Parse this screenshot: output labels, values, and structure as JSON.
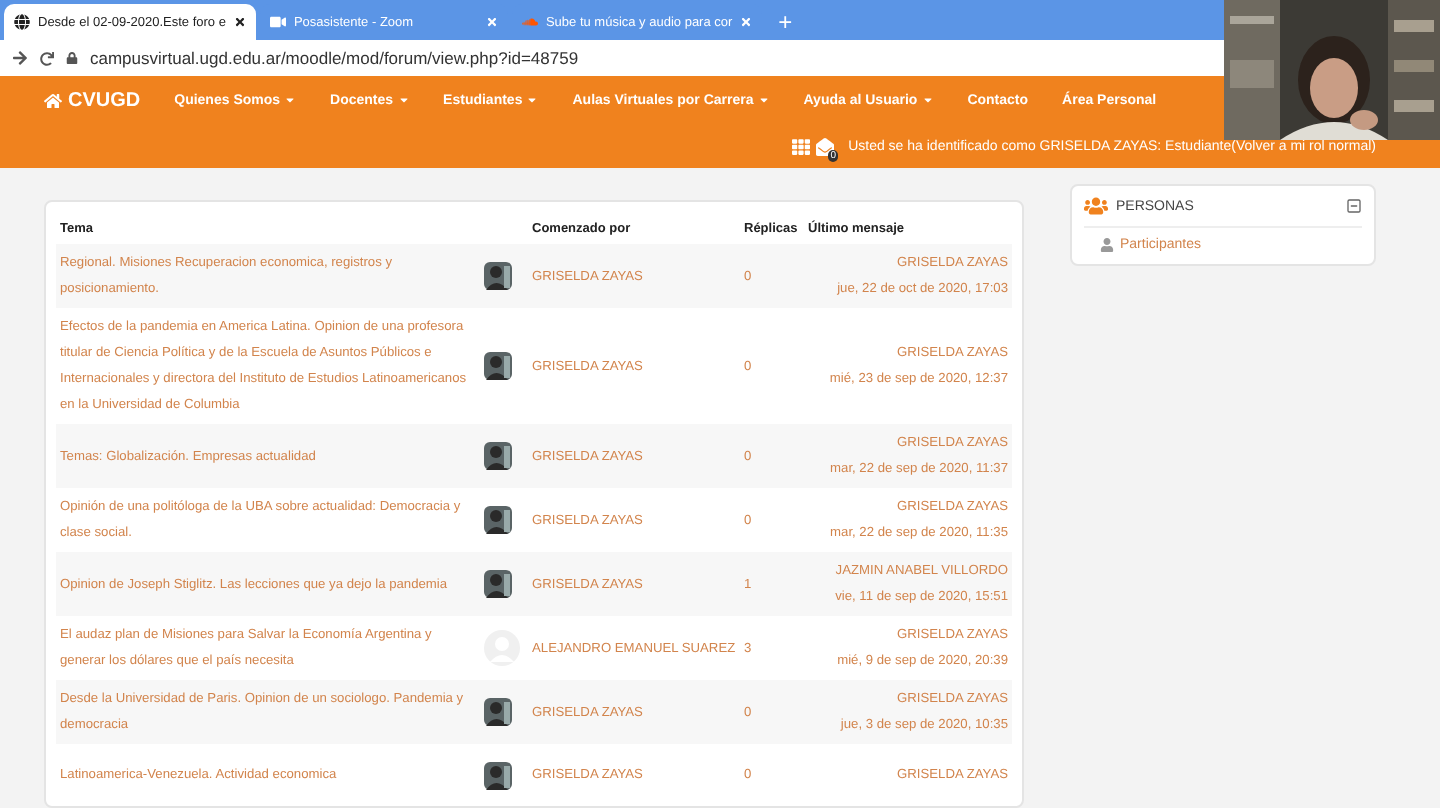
{
  "browser": {
    "tabs": [
      {
        "label": "Desde el 02-09-2020.Este foro e",
        "selected": true
      },
      {
        "label": "Posasistente - Zoom",
        "selected": false
      },
      {
        "label": "Sube tu música y audio para cor",
        "selected": false
      }
    ],
    "new_tab": "+",
    "url": "campusvirtual.ugd.edu.ar/moodle/mod/forum/view.php?id=48759"
  },
  "navbar": {
    "brand": "CVUGD",
    "items": [
      {
        "label": "Quienes Somos",
        "dropdown": true
      },
      {
        "label": "Docentes",
        "dropdown": true
      },
      {
        "label": "Estudiantes",
        "dropdown": true
      },
      {
        "label": "Aulas Virtuales por Carrera",
        "dropdown": true
      },
      {
        "label": "Ayuda al Usuario",
        "dropdown": true
      },
      {
        "label": "Contacto",
        "dropdown": false
      },
      {
        "label": "Área Personal",
        "dropdown": false
      }
    ],
    "notification_count": "0",
    "login_text": "Usted se ha identificado como GRISELDA ZAYAS: Estudiante",
    "login_link": "(Volver a mi rol normal)"
  },
  "table": {
    "columns": [
      "Tema",
      "Comenzado por",
      "Réplicas",
      "Último mensaje"
    ],
    "rows": [
      {
        "topic": "Regional. Misiones Recuperacion economica, registros y posicionamiento.",
        "author": "GRISELDA ZAYAS",
        "replies": "0",
        "last_author": "GRISELDA ZAYAS",
        "last_date": "jue, 22 de oct de 2020, 17:03"
      },
      {
        "topic": "Efectos de la pandemia en America Latina. Opinion de una profesora titular de Ciencia Política y de la Escuela de Asuntos Públicos e Internacionales y directora del Instituto de Estudios Latinoamericanos en la Universidad de Columbia",
        "author": "GRISELDA ZAYAS",
        "replies": "0",
        "last_author": "GRISELDA ZAYAS",
        "last_date": "mié, 23 de sep de 2020, 12:37"
      },
      {
        "topic": "Temas: Globalización. Empresas actualidad",
        "author": "GRISELDA ZAYAS",
        "replies": "0",
        "last_author": "GRISELDA ZAYAS",
        "last_date": "mar, 22 de sep de 2020, 11:37"
      },
      {
        "topic": "Opinión de una politóloga de la UBA sobre actualidad: Democracia y clase social.",
        "author": "GRISELDA ZAYAS",
        "replies": "0",
        "last_author": "GRISELDA ZAYAS",
        "last_date": "mar, 22 de sep de 2020, 11:35"
      },
      {
        "topic": "Opinion de Joseph Stiglitz. Las lecciones que ya dejo la pandemia",
        "author": "GRISELDA ZAYAS",
        "replies": "1",
        "last_author": "JAZMIN ANABEL VILLORDO",
        "last_date": "vie, 11 de sep de 2020, 15:51"
      },
      {
        "topic": "El audaz plan de Misiones para Salvar la Economía Argentina y generar los dólares que el país necesita",
        "kind": "blank",
        "author": "ALEJANDRO EMANUEL SUAREZ",
        "replies": "3",
        "last_author": "GRISELDA ZAYAS",
        "last_date": "mié, 9 de sep de 2020, 20:39"
      },
      {
        "topic": "Desde la Universidad de Paris. Opinion de un sociologo. Pandemia y democracia",
        "author": "GRISELDA ZAYAS",
        "replies": "0",
        "last_author": "GRISELDA ZAYAS",
        "last_date": "jue, 3 de sep de 2020, 10:35"
      },
      {
        "topic": "Latinoamerica-Venezuela. Actividad economica",
        "author": "GRISELDA ZAYAS",
        "replies": "0",
        "last_author": "GRISELDA ZAYAS"
      }
    ]
  },
  "sidebar": {
    "title": "PERSONAS",
    "link": "Participantes"
  }
}
